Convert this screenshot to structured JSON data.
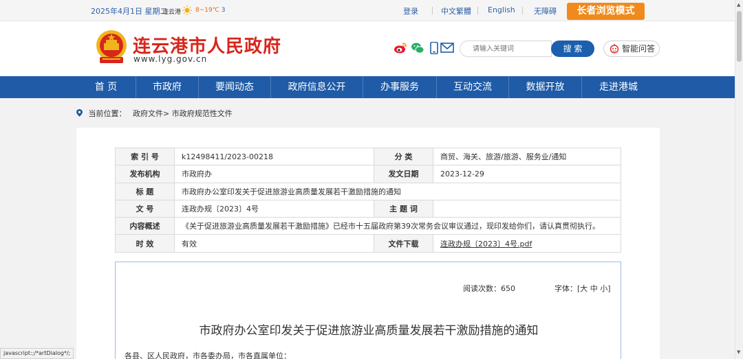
{
  "topbar": {
    "date": "2025年4月1日 星期二",
    "city": "连云港",
    "temp_low": "8",
    "temp_range_text": "~19℃",
    "temp_code": "3",
    "login": "登录",
    "traditional": "中文繁體",
    "english": "English",
    "accessible": "无障碍",
    "elder_mode": "长者浏览模式"
  },
  "header": {
    "title": "连云港市人民政府",
    "url": "www.lyg.gov.cn",
    "search_placeholder": "请输入关键词",
    "search_button": "搜 索",
    "qa_button": "智能问答"
  },
  "nav": {
    "items": [
      "首 页",
      "市政府",
      "要闻动态",
      "政府信息公开",
      "办事服务",
      "互动交流",
      "数据开放",
      "走进港城"
    ]
  },
  "breadcrumb": {
    "label": "当前位置：",
    "path": "政府文件> 市政府规范性文件"
  },
  "meta": {
    "index_label": "索 引 号",
    "index_value": "k12498411/2023-00218",
    "category_label": "分 类",
    "category_value": "商贸、海关、旅游/旅游、服务业/通知",
    "publisher_label": "发布机构",
    "publisher_value": "市政府办",
    "date_label": "发文日期",
    "date_value": "2023-12-29",
    "title_label": "标 题",
    "title_value": "市政府办公室印发关于促进旅游业高质量发展若干激励措施的通知",
    "docno_label": "文 号",
    "docno_value": "连政办规〔2023〕4号",
    "keyword_label": "主 题 词",
    "keyword_value": "",
    "summary_label": "内容概述",
    "summary_value": "《关于促进旅游业高质量发展若干激励措施》已经市十五届政府第39次常务会议审议通过，现印发给你们，请认真贯彻执行。",
    "validity_label": "时 效",
    "validity_value": "有效",
    "download_label": "文件下载",
    "download_value": "连政办规〔2023〕4号.pdf"
  },
  "article": {
    "reads_label": "阅读次数：",
    "reads_value": "650",
    "font_label": "字体：[大 中 小]",
    "title": "市政府办公室印发关于促进旅游业高质量发展若干激励措施的通知",
    "first_line": "各县、区人民政府，市各委办局，市各直属单位："
  },
  "status": {
    "text": "javascript:;/*artDialog*/;"
  },
  "colors": {
    "brand_red": "#d8261c",
    "nav_blue": "#1f5ba6",
    "elder_orange": "#f08a1c"
  },
  "icons": [
    "sun-icon",
    "emblem-icon",
    "weibo-icon",
    "wechat-icon",
    "mobile-icon",
    "mail-icon",
    "robot-icon",
    "location-pin-icon"
  ]
}
